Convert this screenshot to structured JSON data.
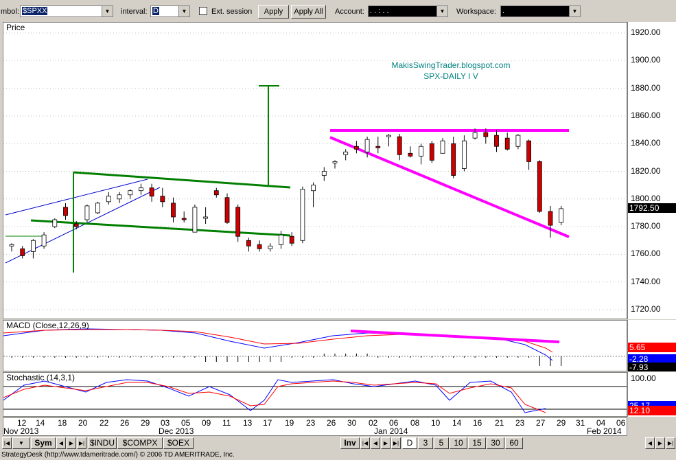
{
  "toolbar": {
    "symbol_label": "mbol:",
    "symbol_value": "$SPXX",
    "interval_label": "interval:",
    "interval_value": "D",
    "ext_session_label": "Ext. session",
    "apply_label": "Apply",
    "apply_all_label": "Apply All",
    "account_label": "Account:",
    "account_value": ". . : . .",
    "workspace_label": "Workspace:",
    "workspace_value": "."
  },
  "price_panel": {
    "title": "Price",
    "annotation_line1": "MakisSwingTrader.blogspot.com",
    "annotation_line2": "SPX-DAILY  I V",
    "y_labels": [
      "1920.00",
      "1900.00",
      "1880.00",
      "1860.00",
      "1840.00",
      "1820.00",
      "1800.00",
      "1780.00",
      "1760.00",
      "1740.00",
      "1720.00"
    ],
    "last_price": "1792.50"
  },
  "macd_panel": {
    "title": "MACD (Close,12,26,9)",
    "values": [
      "5.65",
      "-2.28",
      "-7.93"
    ]
  },
  "stoch_panel": {
    "title": "Stochastic (14,3,1)",
    "top_label": "100.00",
    "values": [
      "25.17",
      "12.10"
    ]
  },
  "date_axis": {
    "day_labels": [
      "12",
      "14",
      "18",
      "20",
      "22",
      "26",
      "29",
      "03",
      "05",
      "09",
      "11",
      "13",
      "17",
      "19",
      "23",
      "26",
      "30",
      "02",
      "06",
      "08",
      "10",
      "14",
      "16",
      "21",
      "23",
      "27",
      "29",
      "31",
      "04",
      "06"
    ],
    "month_labels": [
      "Nov 2013",
      "Dec 2013",
      "Jan 2014",
      "Feb 2014"
    ]
  },
  "tabs": {
    "sym": "Sym",
    "symbols": [
      "$INDU",
      "$COMPX",
      "$OEX"
    ],
    "inv": "Inv",
    "intervals": [
      "D",
      "3",
      "5",
      "10",
      "15",
      "30",
      "60"
    ]
  },
  "status_text": "StrategyDesk (http://www.tdameritrade.com/) © 2006 TD AMERITRADE, Inc.",
  "colors": {
    "up": "#ffffff",
    "down": "#cc0000",
    "wick": "#000000",
    "trendline_green": "#007f00",
    "trendline_magenta": "#ff00ff",
    "channel_blue": "#0000cc",
    "macd": "#0000ff",
    "signal": "#ff0000",
    "price_badge": "#000000"
  },
  "chart_data": {
    "type": "candlestick",
    "ylim": [
      1710,
      1930
    ],
    "candles": [
      {
        "date": "2013-11-12",
        "o": 1766,
        "h": 1768,
        "l": 1762,
        "c": 1767
      },
      {
        "date": "2013-11-13",
        "o": 1764,
        "h": 1766,
        "l": 1757,
        "c": 1759
      },
      {
        "date": "2013-11-14",
        "o": 1762,
        "h": 1771,
        "l": 1757,
        "c": 1770
      },
      {
        "date": "2013-11-15",
        "o": 1766,
        "h": 1776,
        "l": 1764,
        "c": 1774
      },
      {
        "date": "2013-11-18",
        "o": 1780,
        "h": 1786,
        "l": 1779,
        "c": 1785
      },
      {
        "date": "2013-11-19",
        "o": 1794,
        "h": 1797,
        "l": 1785,
        "c": 1788
      },
      {
        "date": "2013-11-20",
        "o": 1782,
        "h": 1784,
        "l": 1778,
        "c": 1780
      },
      {
        "date": "2013-11-21",
        "o": 1785,
        "h": 1796,
        "l": 1783,
        "c": 1795
      },
      {
        "date": "2013-11-22",
        "o": 1790,
        "h": 1798,
        "l": 1789,
        "c": 1797
      },
      {
        "date": "2013-11-25",
        "o": 1798,
        "h": 1805,
        "l": 1796,
        "c": 1802
      },
      {
        "date": "2013-11-26",
        "o": 1800,
        "h": 1805,
        "l": 1797,
        "c": 1803
      },
      {
        "date": "2013-11-27",
        "o": 1803,
        "h": 1807,
        "l": 1800,
        "c": 1806
      },
      {
        "date": "2013-11-29",
        "o": 1806,
        "h": 1811,
        "l": 1803,
        "c": 1808
      },
      {
        "date": "2013-12-02",
        "o": 1808,
        "h": 1811,
        "l": 1798,
        "c": 1802
      },
      {
        "date": "2013-12-03",
        "o": 1802,
        "h": 1808,
        "l": 1794,
        "c": 1798
      },
      {
        "date": "2013-12-04",
        "o": 1797,
        "h": 1801,
        "l": 1783,
        "c": 1787
      },
      {
        "date": "2013-12-05",
        "o": 1786,
        "h": 1791,
        "l": 1783,
        "c": 1785
      },
      {
        "date": "2013-12-06",
        "o": 1776,
        "h": 1796,
        "l": 1776,
        "c": 1794
      },
      {
        "date": "2013-12-09",
        "o": 1786,
        "h": 1794,
        "l": 1782,
        "c": 1787
      },
      {
        "date": "2013-12-10",
        "o": 1806,
        "h": 1808,
        "l": 1801,
        "c": 1803
      },
      {
        "date": "2013-12-11",
        "o": 1801,
        "h": 1804,
        "l": 1782,
        "c": 1783
      },
      {
        "date": "2013-12-12",
        "o": 1794,
        "h": 1796,
        "l": 1769,
        "c": 1773
      },
      {
        "date": "2013-12-13",
        "o": 1770,
        "h": 1772,
        "l": 1762,
        "c": 1766
      },
      {
        "date": "2013-12-16",
        "o": 1767,
        "h": 1770,
        "l": 1762,
        "c": 1764
      },
      {
        "date": "2013-12-17",
        "o": 1764,
        "h": 1768,
        "l": 1762,
        "c": 1766
      },
      {
        "date": "2013-12-18",
        "o": 1767,
        "h": 1777,
        "l": 1764,
        "c": 1774
      },
      {
        "date": "2013-12-19",
        "o": 1773,
        "h": 1776,
        "l": 1766,
        "c": 1768
      },
      {
        "date": "2013-12-20",
        "o": 1770,
        "h": 1809,
        "l": 1768,
        "c": 1807
      },
      {
        "date": "2013-12-23",
        "o": 1806,
        "h": 1812,
        "l": 1794,
        "c": 1810
      },
      {
        "date": "2013-12-24",
        "o": 1817,
        "h": 1823,
        "l": 1813,
        "c": 1820
      },
      {
        "date": "2013-12-26",
        "o": 1826,
        "h": 1828,
        "l": 1822,
        "c": 1827
      },
      {
        "date": "2013-12-27",
        "o": 1832,
        "h": 1836,
        "l": 1828,
        "c": 1834
      },
      {
        "date": "2013-12-30",
        "o": 1838,
        "h": 1842,
        "l": 1833,
        "c": 1836
      },
      {
        "date": "2013-12-31",
        "o": 1834,
        "h": 1845,
        "l": 1830,
        "c": 1843
      },
      {
        "date": "2014-01-02",
        "o": 1838,
        "h": 1845,
        "l": 1833,
        "c": 1837
      },
      {
        "date": "2014-01-03",
        "o": 1845,
        "h": 1847,
        "l": 1838,
        "c": 1846
      },
      {
        "date": "2014-01-06",
        "o": 1845,
        "h": 1847,
        "l": 1828,
        "c": 1832
      },
      {
        "date": "2014-01-07",
        "o": 1833,
        "h": 1838,
        "l": 1830,
        "c": 1831
      },
      {
        "date": "2014-01-08",
        "o": 1831,
        "h": 1840,
        "l": 1825,
        "c": 1838
      },
      {
        "date": "2014-01-09",
        "o": 1840,
        "h": 1842,
        "l": 1826,
        "c": 1828
      },
      {
        "date": "2014-01-10",
        "o": 1833,
        "h": 1844,
        "l": 1833,
        "c": 1842
      },
      {
        "date": "2014-01-13",
        "o": 1840,
        "h": 1845,
        "l": 1815,
        "c": 1817
      },
      {
        "date": "2014-01-14",
        "o": 1822,
        "h": 1846,
        "l": 1820,
        "c": 1842
      },
      {
        "date": "2014-01-15",
        "o": 1844,
        "h": 1851,
        "l": 1843,
        "c": 1848
      },
      {
        "date": "2014-01-16",
        "o": 1848,
        "h": 1851,
        "l": 1840,
        "c": 1845
      },
      {
        "date": "2014-01-17",
        "o": 1846,
        "h": 1850,
        "l": 1834,
        "c": 1838
      },
      {
        "date": "2014-01-21",
        "o": 1844,
        "h": 1848,
        "l": 1835,
        "c": 1836
      },
      {
        "date": "2014-01-22",
        "o": 1838,
        "h": 1847,
        "l": 1836,
        "c": 1846
      },
      {
        "date": "2014-01-23",
        "o": 1842,
        "h": 1843,
        "l": 1821,
        "c": 1827
      },
      {
        "date": "2014-01-24",
        "o": 1827,
        "h": 1828,
        "l": 1790,
        "c": 1791
      },
      {
        "date": "2014-01-27",
        "o": 1791,
        "h": 1795,
        "l": 1772,
        "c": 1781
      },
      {
        "date": "2014-01-28",
        "o": 1783,
        "h": 1795,
        "l": 1781,
        "c": 1793
      }
    ]
  }
}
